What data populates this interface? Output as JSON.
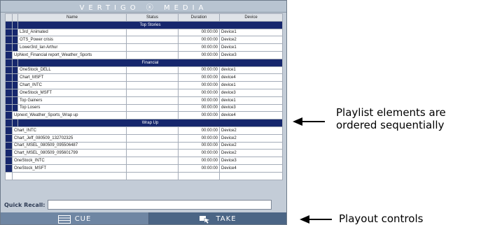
{
  "brand": "VERTIGO ⓧ MEDIA",
  "columns": {
    "name": "Name",
    "status": "Status",
    "duration": "Duration",
    "device": "Device"
  },
  "sections": [
    {
      "title": "Top Stories",
      "rows": [
        {
          "name": "L3rd_Animated",
          "status": "",
          "duration": "00:00:00",
          "device": "Device1",
          "indent": true
        },
        {
          "name": "OTS_Power crisis",
          "status": "",
          "duration": "00:00:00",
          "device": "Device2",
          "indent": true
        },
        {
          "name": "Lower3rd_Ian Arthur",
          "status": "",
          "duration": "00:00:00",
          "device": "Device1",
          "indent": true
        },
        {
          "name": "UpNext_Financial report_Weather_Sports",
          "status": "",
          "duration": "00:00:00",
          "device": "Device3",
          "indent": false
        }
      ]
    },
    {
      "title": "Financial",
      "rows": [
        {
          "name": "OneStock_DELL",
          "status": "",
          "duration": "00:00:00",
          "device": "device1",
          "indent": true
        },
        {
          "name": "Chart_MSFT",
          "status": "",
          "duration": "00:00:00",
          "device": "device4",
          "indent": true
        },
        {
          "name": "Chart_INTC",
          "status": "",
          "duration": "00:00:00",
          "device": "device1",
          "indent": true
        },
        {
          "name": "OneStock_MSFT",
          "status": "",
          "duration": "00:00:00",
          "device": "device3",
          "indent": true
        },
        {
          "name": "Top Gainers",
          "status": "",
          "duration": "00:00:00",
          "device": "device1",
          "indent": true
        },
        {
          "name": "Top Losers",
          "status": "",
          "duration": "00:00:00",
          "device": "device3",
          "indent": true
        },
        {
          "name": "Upnext_Weather_Sports_Wrap up",
          "status": "",
          "duration": "00:00:00",
          "device": "device4",
          "indent": false
        }
      ]
    },
    {
      "title": "Wrap Up",
      "rows": [
        {
          "name": "Chart_INTC",
          "status": "",
          "duration": "00:00:00",
          "device": "Device2",
          "indent": false
        },
        {
          "name": "Chart_Jeff_080509_132702325",
          "status": "",
          "duration": "00:00:00",
          "device": "Device2",
          "indent": false
        },
        {
          "name": "Chart_MSEL_080509_095506487",
          "status": "",
          "duration": "00:00:00",
          "device": "Device2",
          "indent": false
        },
        {
          "name": "Chart_MSEL_080509_095601799",
          "status": "",
          "duration": "00:00:00",
          "device": "Device2",
          "indent": false
        },
        {
          "name": "OneStock_INTC",
          "status": "",
          "duration": "00:00:00",
          "device": "Device3",
          "indent": false
        },
        {
          "name": "OneStock_MSFT",
          "status": "",
          "duration": "00:00:00",
          "device": "Device4",
          "indent": false
        }
      ]
    }
  ],
  "empty_rows": 1,
  "quick_recall": {
    "label": "Quick Recall:",
    "value": ""
  },
  "controls": {
    "cue": "CUE",
    "take": "TAKE"
  },
  "annotations": {
    "playlist": "Playlist elements are ordered sequentially",
    "playout": "Playout controls"
  },
  "colors": {
    "section_bar": "#16276d",
    "panel": "#c3ccd7",
    "cue_button": "#6f86a3",
    "take_button": "#4b6585"
  }
}
